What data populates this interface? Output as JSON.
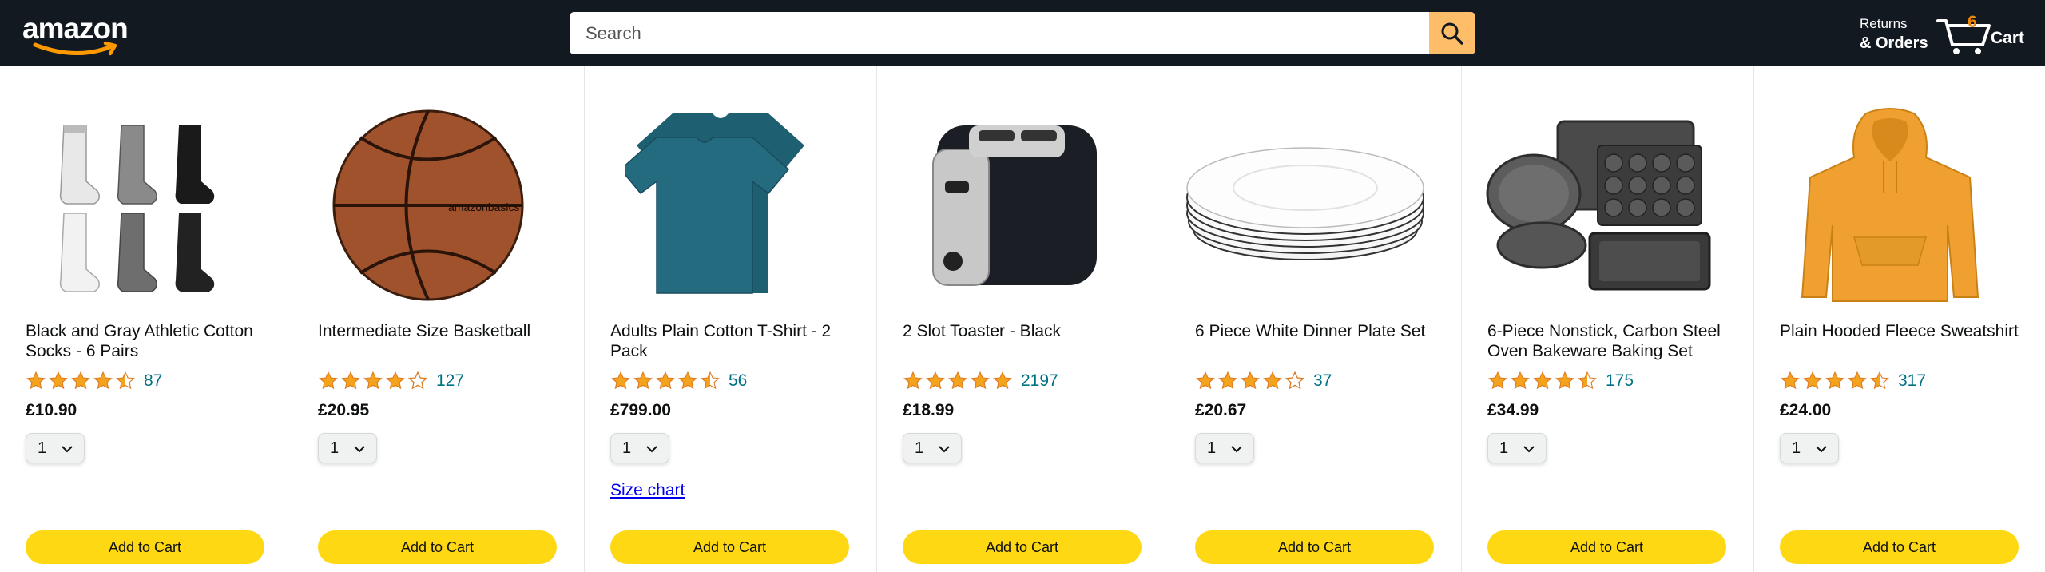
{
  "header": {
    "logo_text": "amazon",
    "search_placeholder": "Search",
    "returns_top": "Returns",
    "returns_bottom": "& Orders",
    "cart_count": "6",
    "cart_label": "Cart"
  },
  "colors": {
    "nav_bg": "#131921",
    "search_button": "#febd69",
    "cart_count": "#f08804",
    "star": "#f4a41c",
    "link": "#007185",
    "add_to_cart": "#ffd814"
  },
  "products": [
    {
      "title": "Black and Gray Athletic Cotton Socks - 6 Pairs",
      "rating": 4.5,
      "reviews": "87",
      "price": "£10.90",
      "qty": "1",
      "add_label": "Add to Cart",
      "image": "socks"
    },
    {
      "title": "Intermediate Size Basketball",
      "rating": 4.0,
      "reviews": "127",
      "price": "£20.95",
      "qty": "1",
      "add_label": "Add to Cart",
      "image": "basketball"
    },
    {
      "title": "Adults Plain Cotton T-Shirt - 2 Pack",
      "rating": 4.5,
      "reviews": "56",
      "price": "£799.00",
      "qty": "1",
      "size_chart": "Size chart",
      "add_label": "Add to Cart",
      "image": "tshirt"
    },
    {
      "title": "2 Slot Toaster - Black",
      "rating": 5.0,
      "reviews": "2197",
      "price": "£18.99",
      "qty": "1",
      "add_label": "Add to Cart",
      "image": "toaster"
    },
    {
      "title": "6 Piece White Dinner Plate Set",
      "rating": 4.0,
      "reviews": "37",
      "price": "£20.67",
      "qty": "1",
      "add_label": "Add to Cart",
      "image": "plates"
    },
    {
      "title": "6-Piece Nonstick, Carbon Steel Oven Bakeware Baking Set",
      "rating": 4.5,
      "reviews": "175",
      "price": "£34.99",
      "qty": "1",
      "add_label": "Add to Cart",
      "image": "bakeware"
    },
    {
      "title": "Plain Hooded Fleece Sweatshirt",
      "rating": 4.5,
      "reviews": "317",
      "price": "£24.00",
      "qty": "1",
      "add_label": "Add to Cart",
      "image": "hoodie"
    }
  ]
}
